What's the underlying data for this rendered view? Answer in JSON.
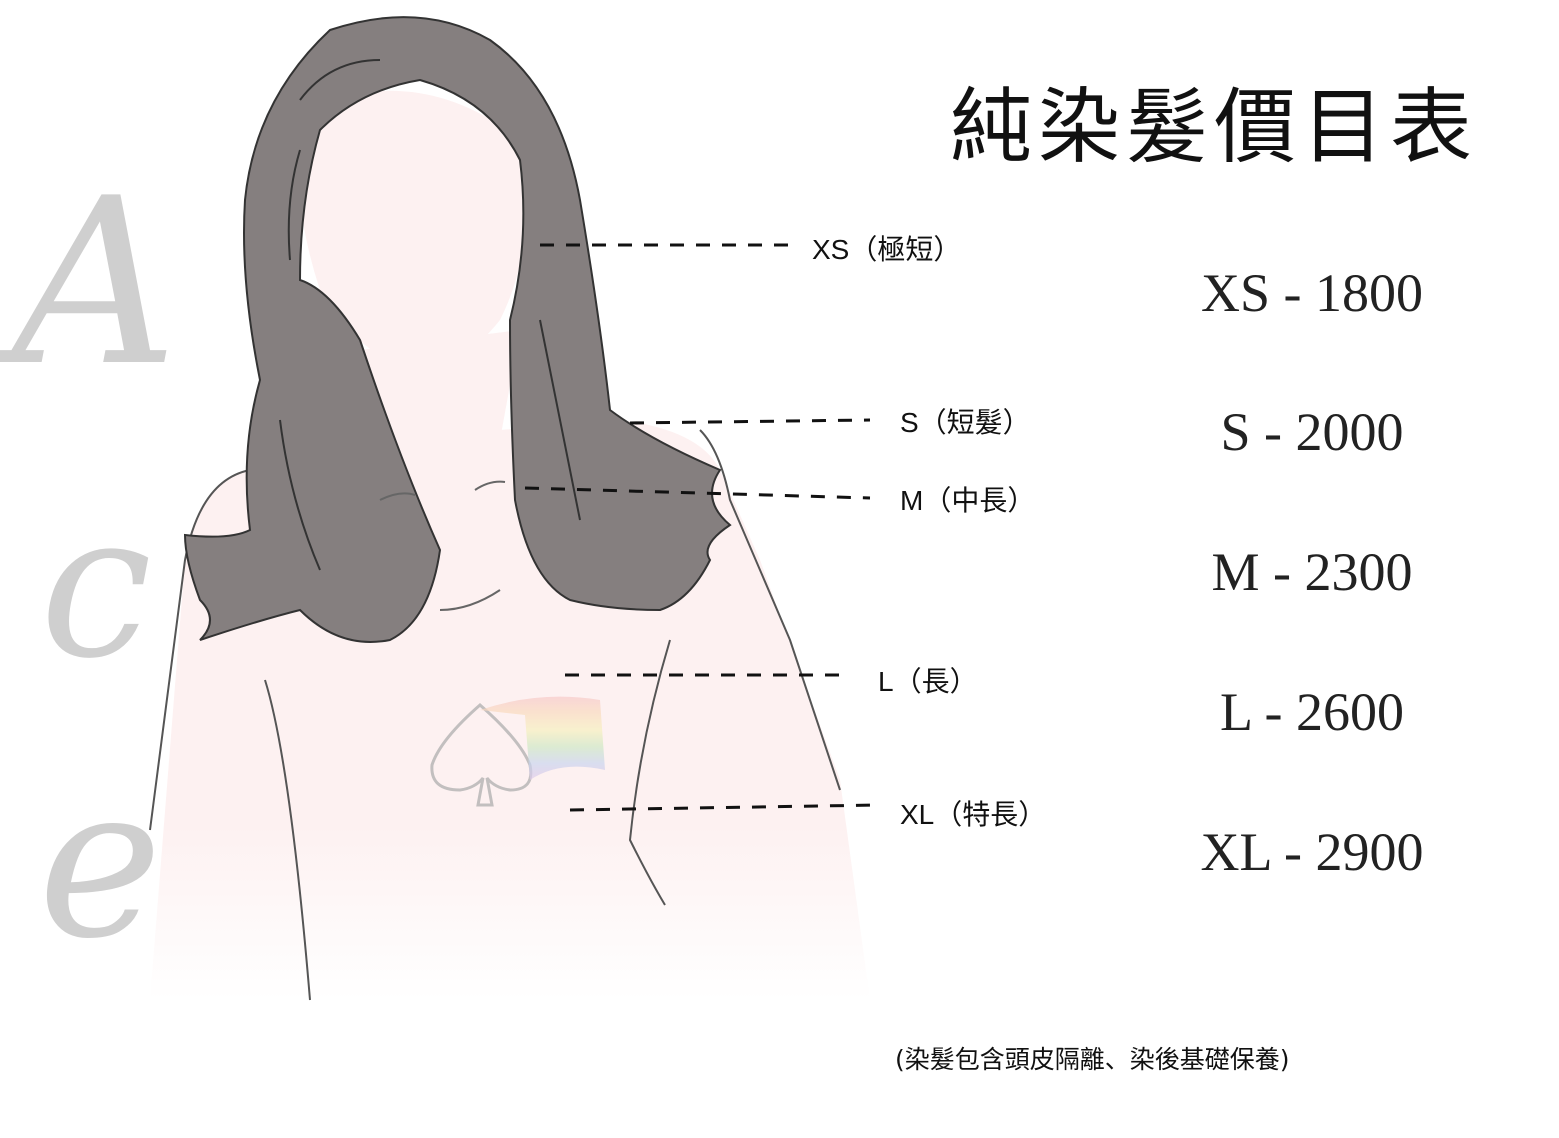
{
  "title": "純染髮價目表",
  "side_letters": [
    "A",
    "c",
    "e"
  ],
  "length_labels": [
    {
      "label": "XS（極短）"
    },
    {
      "label": "S（短髮）"
    },
    {
      "label": "M（中長）"
    },
    {
      "label": "L（長）"
    },
    {
      "label": "XL（特長）"
    }
  ],
  "prices": [
    {
      "text": "XS - 1800"
    },
    {
      "text": "S - 2000"
    },
    {
      "text": "M - 2300"
    },
    {
      "text": "L - 2600"
    },
    {
      "text": "XL - 2900"
    }
  ],
  "note": "(染髮包含頭皮隔離、染後基礎保養)",
  "colors": {
    "hair": "#857f7f",
    "skin": "#fdf1f1",
    "letters": "#cfcfcf"
  },
  "watermark": "spade-rainbow-flag-logo"
}
